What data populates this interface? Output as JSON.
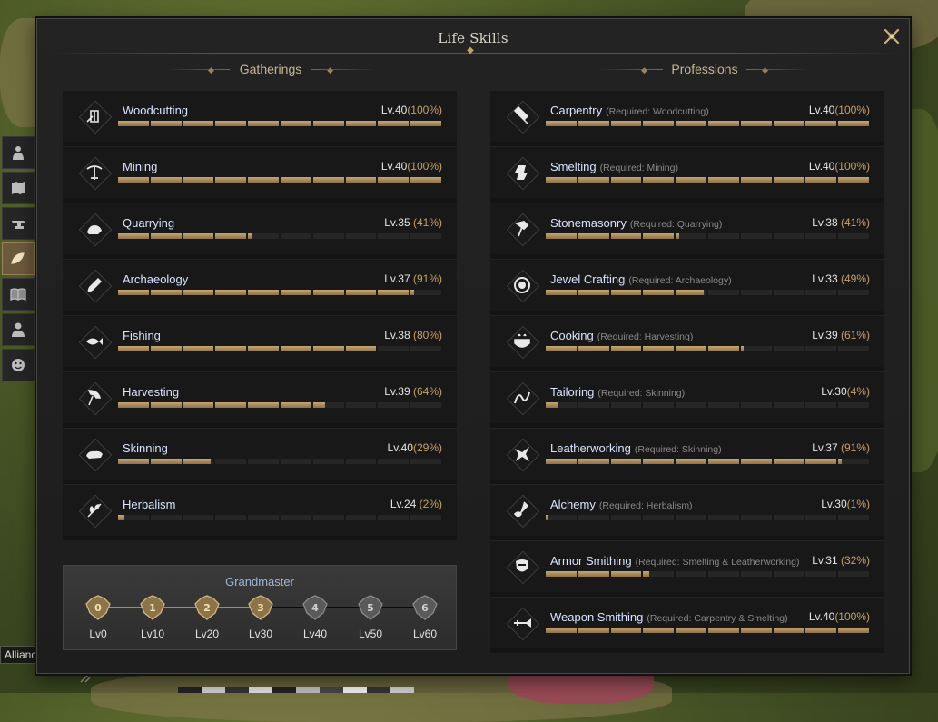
{
  "window": {
    "title": "Life Skills"
  },
  "gatherings": {
    "heading": "Gatherings",
    "skills": [
      {
        "name": "Woodcutting",
        "level": "Lv.40",
        "percent": "(100%)",
        "progress": 1.0,
        "icon": "woodcutting-icon"
      },
      {
        "name": "Mining",
        "level": "Lv.40",
        "percent": "(100%)",
        "progress": 1.0,
        "icon": "mining-icon"
      },
      {
        "name": "Quarrying",
        "level": "Lv.35",
        "percent": " (41%)",
        "progress": 0.41,
        "icon": "quarrying-icon"
      },
      {
        "name": "Archaeology",
        "level": "Lv.37",
        "percent": " (91%)",
        "progress": 0.91,
        "icon": "archaeology-icon"
      },
      {
        "name": "Fishing",
        "level": "Lv.38",
        "percent": " (80%)",
        "progress": 0.8,
        "icon": "fishing-icon"
      },
      {
        "name": "Harvesting",
        "level": "Lv.39",
        "percent": " (64%)",
        "progress": 0.64,
        "icon": "harvesting-icon"
      },
      {
        "name": "Skinning",
        "level": "Lv.40",
        "percent": "(29%)",
        "progress": 0.29,
        "icon": "skinning-icon"
      },
      {
        "name": "Herbalism",
        "level": "Lv.24",
        "percent": " (2%)",
        "progress": 0.02,
        "icon": "herbalism-icon"
      }
    ]
  },
  "professions": {
    "heading": "Professions",
    "skills": [
      {
        "name": "Carpentry",
        "req": "(Required: Woodcutting)",
        "level": "Lv.40",
        "percent": "(100%)",
        "progress": 1.0,
        "icon": "carpentry-icon"
      },
      {
        "name": "Smelting",
        "req": "(Required: Mining)",
        "level": "Lv.40",
        "percent": "(100%)",
        "progress": 1.0,
        "icon": "smelting-icon"
      },
      {
        "name": "Stonemasonry",
        "req": "(Required: Quarrying)",
        "level": "Lv.38",
        "percent": " (41%)",
        "progress": 0.41,
        "icon": "stonemasonry-icon"
      },
      {
        "name": "Jewel Crafting",
        "req": "(Required: Archaeology)",
        "level": "Lv.33",
        "percent": " (49%)",
        "progress": 0.49,
        "icon": "jewel-crafting-icon"
      },
      {
        "name": "Cooking",
        "req": "(Required: Harvesting)",
        "level": "Lv.39",
        "percent": " (61%)",
        "progress": 0.61,
        "icon": "cooking-icon"
      },
      {
        "name": "Tailoring",
        "req": "(Required: Skinning)",
        "level": "Lv.30",
        "percent": "(4%)",
        "progress": 0.04,
        "icon": "tailoring-icon"
      },
      {
        "name": "Leatherworking",
        "req": "(Required: Skinning)",
        "level": "Lv.37",
        "percent": " (91%)",
        "progress": 0.91,
        "icon": "leatherworking-icon"
      },
      {
        "name": "Alchemy",
        "req": "(Required: Herbalism)",
        "level": "Lv.30",
        "percent": "(1%)",
        "progress": 0.01,
        "icon": "alchemy-icon"
      },
      {
        "name": "Armor Smithing",
        "req": "(Required: Smelting & Leatherworking)",
        "level": "Lv.31",
        "percent": " (32%)",
        "progress": 0.32,
        "icon": "armor-smithing-icon"
      },
      {
        "name": "Weapon Smithing",
        "req": "(Required: Carpentry & Smelting)",
        "level": "Lv.40",
        "percent": "(100%)",
        "progress": 1.0,
        "icon": "weapon-smithing-icon"
      }
    ]
  },
  "grandmaster": {
    "title": "Grandmaster",
    "tiers": [
      {
        "num": "0",
        "label": "Lv0",
        "unlocked": true
      },
      {
        "num": "1",
        "label": "Lv10",
        "unlocked": true
      },
      {
        "num": "2",
        "label": "Lv20",
        "unlocked": true
      },
      {
        "num": "3",
        "label": "Lv30",
        "unlocked": true
      },
      {
        "num": "4",
        "label": "Lv40",
        "unlocked": false
      },
      {
        "num": "5",
        "label": "Lv50",
        "unlocked": false
      },
      {
        "num": "6",
        "label": "Lv60",
        "unlocked": false
      }
    ]
  },
  "side_tabs": [
    {
      "icon": "character-icon",
      "active": false
    },
    {
      "icon": "map-icon",
      "active": false
    },
    {
      "icon": "anvil-icon",
      "active": false
    },
    {
      "icon": "life-skills-icon",
      "active": true
    },
    {
      "icon": "book-icon",
      "active": false
    },
    {
      "icon": "social-icon",
      "active": false
    },
    {
      "icon": "emote-icon",
      "active": false
    }
  ],
  "hud": {
    "alliance_label": "Alliance"
  },
  "colors": {
    "accent": "#c8a065",
    "bar_fill": "#b8966a",
    "name_text": "#d9e4ff"
  }
}
